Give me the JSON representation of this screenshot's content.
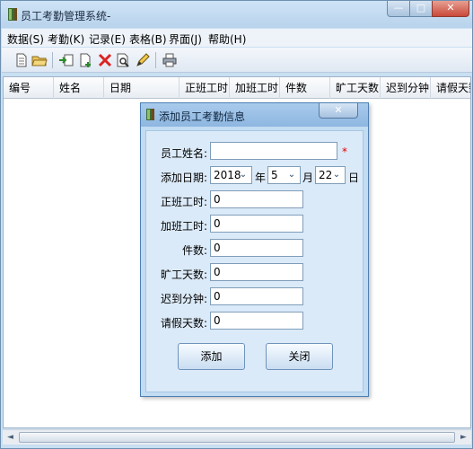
{
  "window": {
    "title": "员工考勤管理系统-",
    "controls": {
      "minimize": "—",
      "maximize": "□",
      "close": "✕"
    }
  },
  "menu": [
    "数据(S)",
    "考勤(K)",
    "记录(E)",
    "表格(B)",
    "界面(J)",
    "帮助(H)"
  ],
  "toolbar": {
    "icons": [
      "new-file-icon",
      "open-folder-icon",
      "import-icon",
      "add-document-icon",
      "delete-icon",
      "preview-icon",
      "edit-pencil-icon",
      "print-icon"
    ]
  },
  "table": {
    "columns": [
      "编号",
      "姓名",
      "日期",
      "正班工时",
      "加班工时",
      "件数",
      "旷工天数",
      "迟到分钟",
      "请假天数"
    ]
  },
  "scrollbar": {
    "left": "◄",
    "right": "►"
  },
  "dialog": {
    "title": "添加员工考勤信息",
    "close": "✕",
    "name_label": "员工姓名:",
    "name_value": "",
    "required_mark": "*",
    "date_label": "添加日期:",
    "year": "2018",
    "year_unit": "年",
    "month": "5",
    "month_unit": "月",
    "day": "22",
    "day_unit": "日",
    "dropdown_arrow": "⌄",
    "regular_hours_label": "正班工时:",
    "regular_hours": "0",
    "overtime_label": "加班工时:",
    "overtime": "0",
    "pieces_label": "件数:",
    "pieces": "0",
    "absent_label": "旷工天数:",
    "absent": "0",
    "late_label": "迟到分钟:",
    "late": "0",
    "leave_label": "请假天数:",
    "leave": "0",
    "add_button": "添加",
    "close_button": "关闭"
  }
}
